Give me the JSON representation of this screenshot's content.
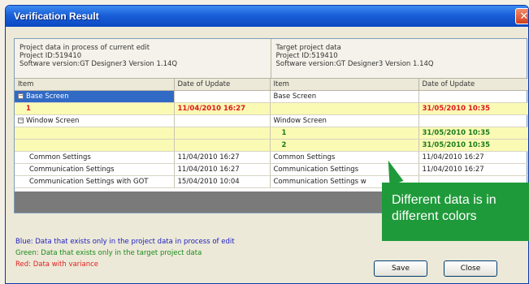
{
  "window": {
    "title": "Verification Result",
    "close_glyph": "✕"
  },
  "project_current": {
    "line1": "Project data in process of current edit",
    "line2": "Project ID:519410",
    "line3": "Software version:GT Designer3 Version 1.14Q"
  },
  "project_target": {
    "line1": "Target project data",
    "line2": "Project ID:519410",
    "line3": "Software version:GT Designer3 Version 1.14Q"
  },
  "columns": [
    "Item",
    "Date of Update",
    "Item",
    "Date of Update"
  ],
  "rows": [
    {
      "left_item": "Base Screen",
      "left_date": "",
      "right_item": "Base Screen",
      "right_date": ""
    },
    {
      "left_item": "1",
      "left_date": "11/04/2010 16:27",
      "right_item": "",
      "right_date": "31/05/2010 10:35"
    },
    {
      "left_item": "Window Screen",
      "left_date": "",
      "right_item": "Window Screen",
      "right_date": ""
    },
    {
      "left_item": "",
      "left_date": "",
      "right_item": "1",
      "right_date": "31/05/2010 10:35"
    },
    {
      "left_item": "",
      "left_date": "",
      "right_item": "2",
      "right_date": "31/05/2010 10:35"
    },
    {
      "left_item": "Common Settings",
      "left_date": "11/04/2010 16:27",
      "right_item": "Common Settings",
      "right_date": "11/04/2010 16:27"
    },
    {
      "left_item": "Communication Settings",
      "left_date": "11/04/2010 16:27",
      "right_item": "Communication Settings",
      "right_date": "11/04/2010 16:27"
    },
    {
      "left_item": "Communication Settings with GOT",
      "left_date": "15/04/2010 10:04",
      "right_item": "Communication Settings w",
      "right_date": ""
    }
  ],
  "expander_symbol": "−",
  "legend": {
    "blue": "Blue: Data that exists only in the project data in process of edit",
    "green": "Green: Data that exists only in the target project data",
    "red": "Red: Data with variance"
  },
  "buttons": {
    "save": "Save",
    "close": "Close"
  },
  "callout": {
    "line1": "Different data is in",
    "line2": "different colors"
  },
  "colors": {
    "title_bar": "#1a5fd8",
    "selection": "#316ac5",
    "variance": "#e01818",
    "target_only": "#1a7a1a",
    "callout": "#1f9a3a"
  }
}
